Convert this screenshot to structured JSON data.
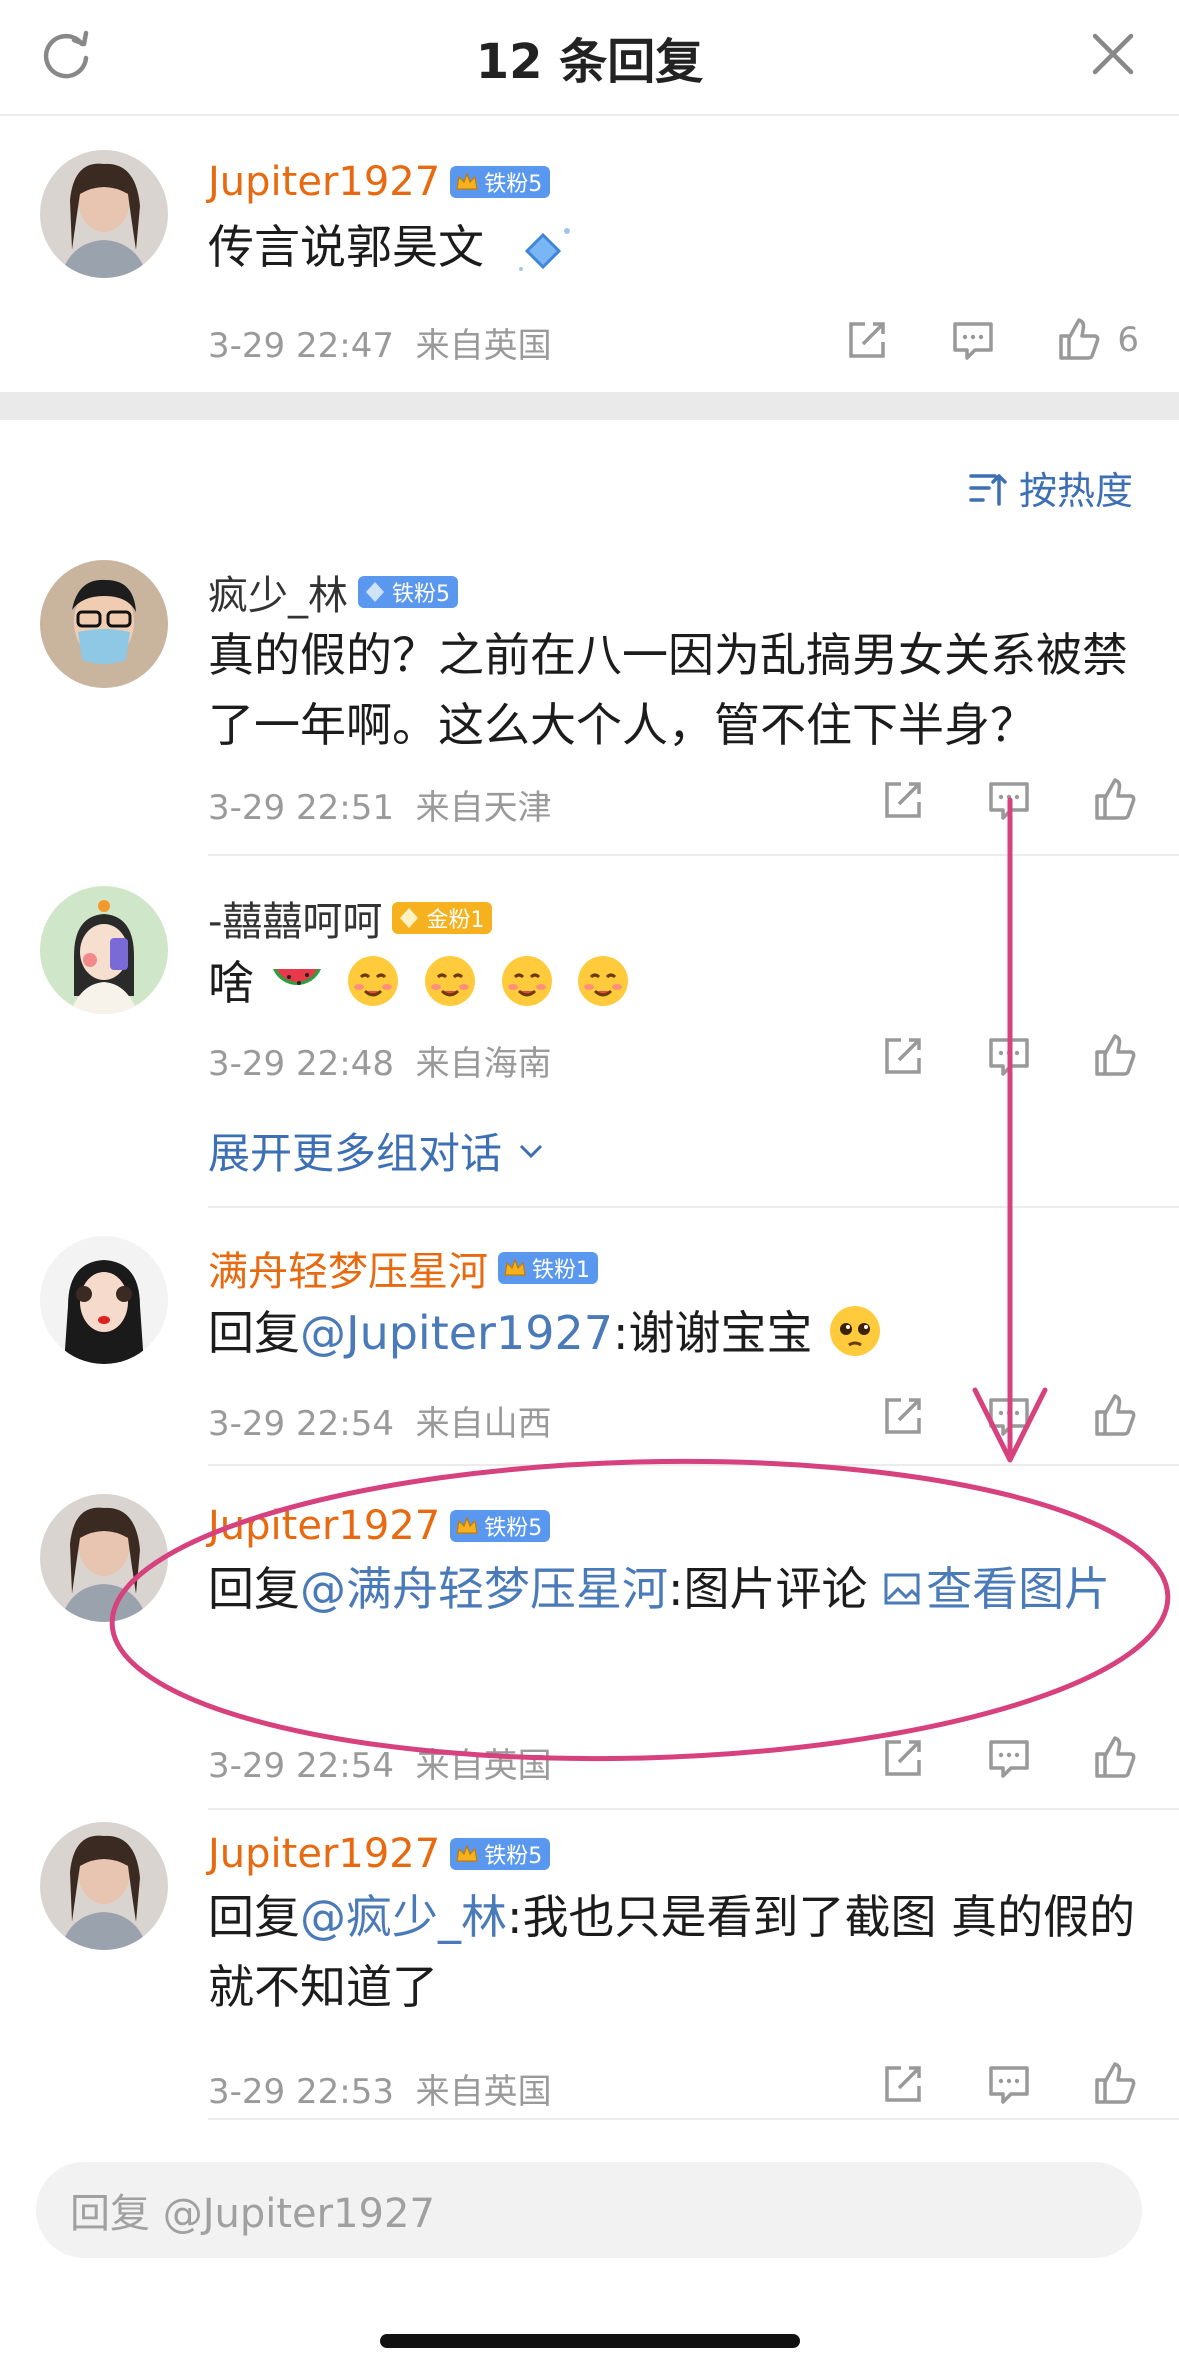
{
  "header": {
    "title": "12 条回复"
  },
  "main_comment": {
    "name": "Jupiter1927",
    "badge": "铁粉5",
    "text": "传言说郭昊文",
    "time": "3-29 22:47",
    "location": "来自英国",
    "like_count": "6"
  },
  "sort": {
    "label": "按热度"
  },
  "replies": [
    {
      "name": "疯少_林",
      "badge": "铁粉5",
      "text": "真的假的？之前在八一因为乱搞男女关系被禁了一年啊。这么大个人，管不住下半身？",
      "time": "3-29 22:51",
      "location": "来自天津"
    },
    {
      "name": "-囍囍呵呵",
      "badge": "金粉1",
      "text": "啥",
      "time": "3-29 22:48",
      "location": "来自海南"
    },
    {
      "name": "满舟轻梦压星河",
      "badge": "铁粉1",
      "reply_prefix": "回复",
      "mention": "@Jupiter1927",
      "text": ":谢谢宝宝",
      "time": "3-29 22:54",
      "location": "来自山西"
    },
    {
      "name": "Jupiter1927",
      "badge": "铁粉5",
      "reply_prefix": "回复",
      "mention": "@满舟轻梦压星河",
      "text": ":图片评论 ",
      "link": "查看图片",
      "time": "3-29 22:54",
      "location": "来自英国"
    },
    {
      "name": "Jupiter1927",
      "badge": "铁粉5",
      "reply_prefix": "回复",
      "mention": "@疯少_林",
      "text": ":我也只是看到了截图 真的假的就不知道了",
      "time": "3-29 22:53",
      "location": "来自英国"
    }
  ],
  "expand": {
    "label": "展开更多组对话"
  },
  "input": {
    "placeholder": "回复 @Jupiter1927"
  },
  "colors": {
    "accent_blue": "#3d6fb4",
    "name_orange": "#e86a10",
    "annotation_pink": "#d6417e"
  }
}
